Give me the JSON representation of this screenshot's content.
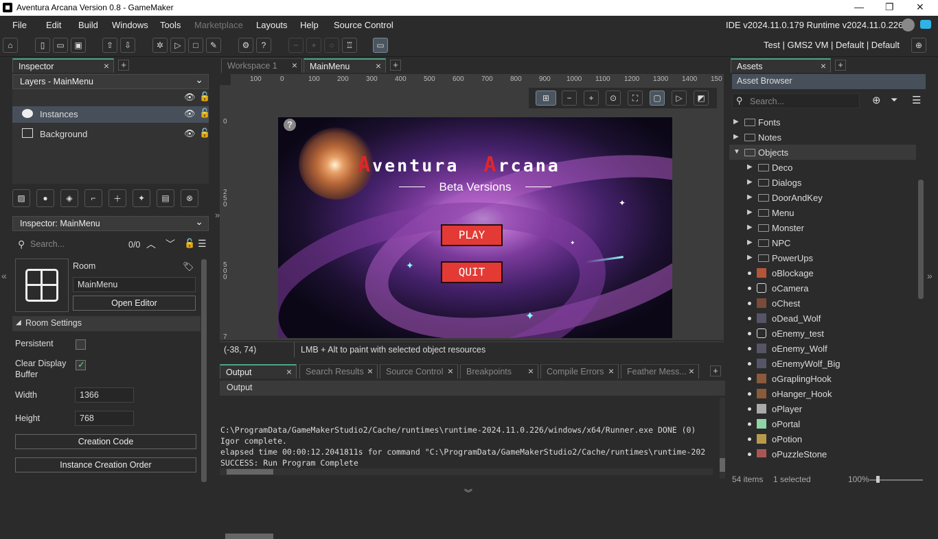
{
  "window": {
    "title": "Aventura Arcana Version 0.8 - GameMaker"
  },
  "menubar": {
    "items": [
      "File",
      "Edit",
      "Build",
      "Windows",
      "Tools",
      "Marketplace",
      "Layouts",
      "Help",
      "Source Control"
    ],
    "version_text": "IDE v2024.11.0.179  Runtime v2024.11.0.226"
  },
  "toolbar": {
    "target": "Test  |  GMS2 VM  |  Default  |  Default"
  },
  "inspector": {
    "tab": "Inspector",
    "layers_dropdown": "Layers - MainMenu",
    "layers": [
      {
        "label": "Instances",
        "selected": true
      },
      {
        "label": "Background",
        "selected": false
      }
    ],
    "inspector_dropdown": "Inspector: MainMenu",
    "search_placeholder": "Search...",
    "search_count": "0/0",
    "room_type": "Room",
    "room_name": "MainMenu",
    "open_editor": "Open Editor",
    "room_settings": "Room Settings",
    "persistent": "Persistent",
    "clear_display_line1": "Clear Display",
    "clear_display_line2": "Buffer",
    "width_label": "Width",
    "width_value": "1366",
    "height_label": "Height",
    "height_value": "768",
    "creation_code": "Creation Code",
    "instance_order": "Instance Creation Order"
  },
  "editor": {
    "tabs": [
      "Workspace 1",
      "MainMenu"
    ],
    "ruler_labels": [
      "100",
      "0",
      "100",
      "200",
      "300",
      "400",
      "500",
      "600",
      "700",
      "800",
      "900",
      "1000",
      "1100",
      "1200",
      "1300",
      "1400",
      "150"
    ],
    "vruler_labels": [
      "0",
      "250",
      "500",
      "7"
    ],
    "coords": "(-38, 74)",
    "hint": "LMB + Alt to paint with selected object resources",
    "game": {
      "title_word1_first": "A",
      "title_word1_rest": "ventura",
      "title_word2_first": "A",
      "title_word2_rest": "rcana",
      "subtitle": "Beta Versions",
      "play": "PLAY",
      "quit": "QUIT",
      "help_glyph": "?"
    }
  },
  "output": {
    "tabs": [
      "Output",
      "Search Results",
      "Source Control",
      "Breakpoints",
      "Compile Errors",
      "Feather Mess..."
    ],
    "header": "Output",
    "lines": [
      "C:\\ProgramData/GameMakerStudio2/Cache/runtimes\\runtime-2024.11.0.226/windows/x64/Runner.exe DONE (0)",
      "Igor complete.",
      "elapsed time 00:00:12.2041811s for command \"C:\\ProgramData/GameMakerStudio2/Cache/runtimes\\runtime-202",
      "SUCCESS: Run Program Complete"
    ]
  },
  "assets": {
    "tab": "Assets",
    "browser_title": "Asset Browser",
    "search_placeholder": "Search...",
    "tree": [
      {
        "label": "Fonts",
        "type": "folder",
        "level": 0,
        "open": false
      },
      {
        "label": "Notes",
        "type": "folder",
        "level": 0,
        "open": false
      },
      {
        "label": "Objects",
        "type": "folder",
        "level": 0,
        "open": true
      },
      {
        "label": "Deco",
        "type": "folder",
        "level": 1
      },
      {
        "label": "Dialogs",
        "type": "folder",
        "level": 1
      },
      {
        "label": "DoorAndKey",
        "type": "folder",
        "level": 1
      },
      {
        "label": "Menu",
        "type": "folder",
        "level": 1
      },
      {
        "label": "Monster",
        "type": "folder",
        "level": 1
      },
      {
        "label": "NPC",
        "type": "folder",
        "level": 1
      },
      {
        "label": "PowerUps",
        "type": "folder",
        "level": 1
      },
      {
        "label": "oBlockage",
        "type": "object",
        "color": "#b4553a"
      },
      {
        "label": "oCamera",
        "type": "object",
        "color": "outline"
      },
      {
        "label": "oChest",
        "type": "object",
        "color": "#7a4a3a"
      },
      {
        "label": "oDead_Wolf",
        "type": "object",
        "color": "#556"
      },
      {
        "label": "oEnemy_test",
        "type": "object",
        "color": "outline"
      },
      {
        "label": "oEnemy_Wolf",
        "type": "object",
        "color": "#556"
      },
      {
        "label": "oEnemyWolf_Big",
        "type": "object",
        "color": "#556"
      },
      {
        "label": "oGraplingHook",
        "type": "object",
        "color": "#8a5a3a"
      },
      {
        "label": "oHanger_Hook",
        "type": "object",
        "color": "#8a5a3a"
      },
      {
        "label": "oPlayer",
        "type": "object",
        "color": "#aaa"
      },
      {
        "label": "oPortal",
        "type": "object",
        "color": "#8fd4a6"
      },
      {
        "label": "oPotion",
        "type": "object",
        "color": "#b89a4a"
      },
      {
        "label": "oPuzzleStone",
        "type": "object",
        "color": "#a55"
      }
    ],
    "status_items": "54 items",
    "status_selected": "1 selected",
    "zoom": "100%"
  }
}
